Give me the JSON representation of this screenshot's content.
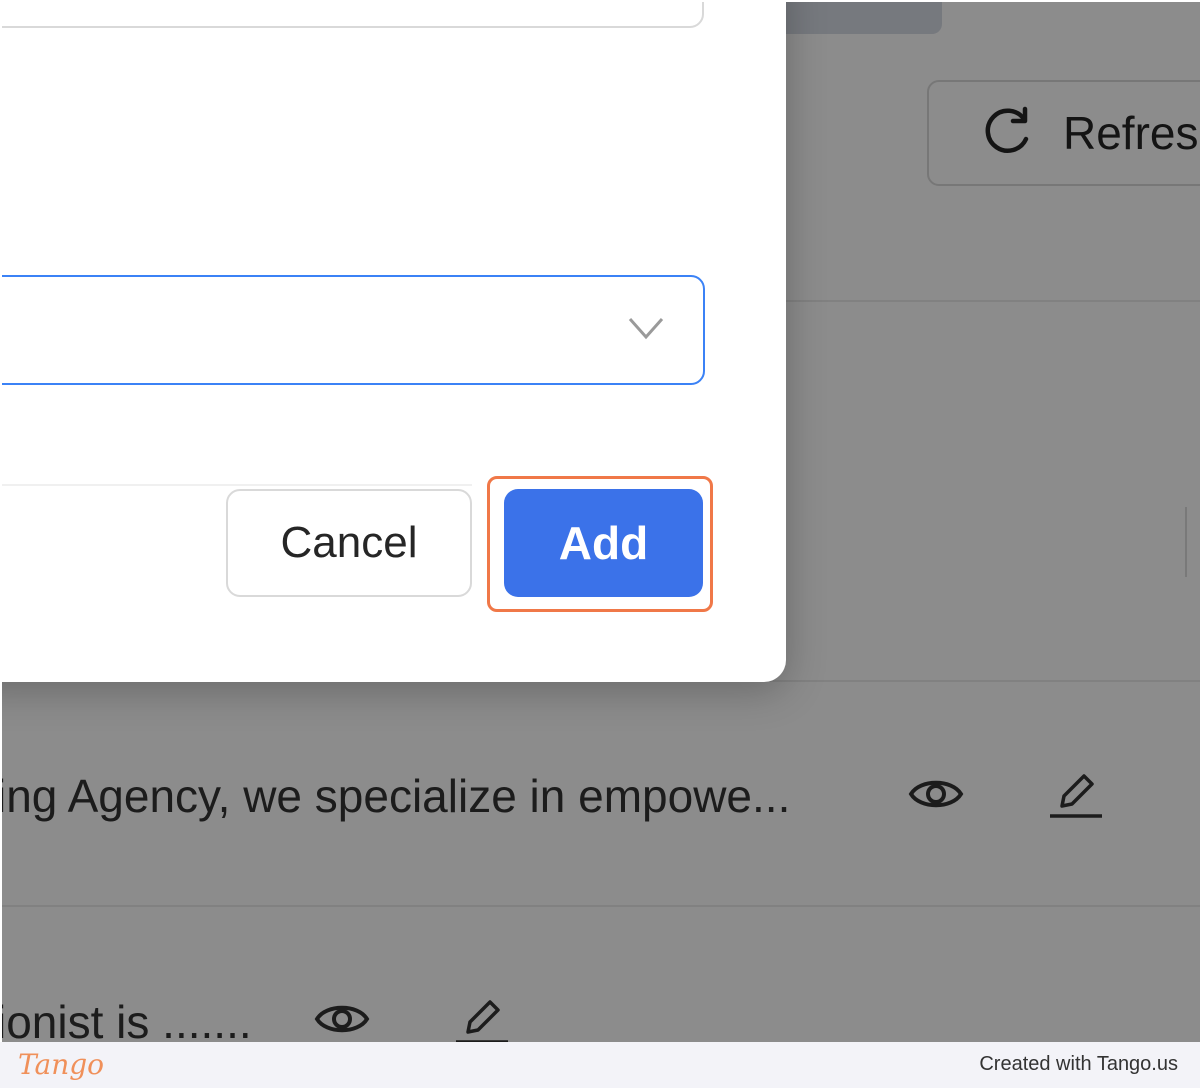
{
  "background": {
    "refresh_label": "Refresh",
    "rows": [
      {
        "text": "ing Agency, we specialize in empowe..."
      },
      {
        "text": "ionist is ......."
      }
    ]
  },
  "modal": {
    "cancel_label": "Cancel",
    "add_label": "Add",
    "accent_color": "#3b72e9",
    "highlight_color": "#f07848"
  },
  "footer": {
    "logo": "Tango",
    "credit": "Created with Tango.us"
  }
}
